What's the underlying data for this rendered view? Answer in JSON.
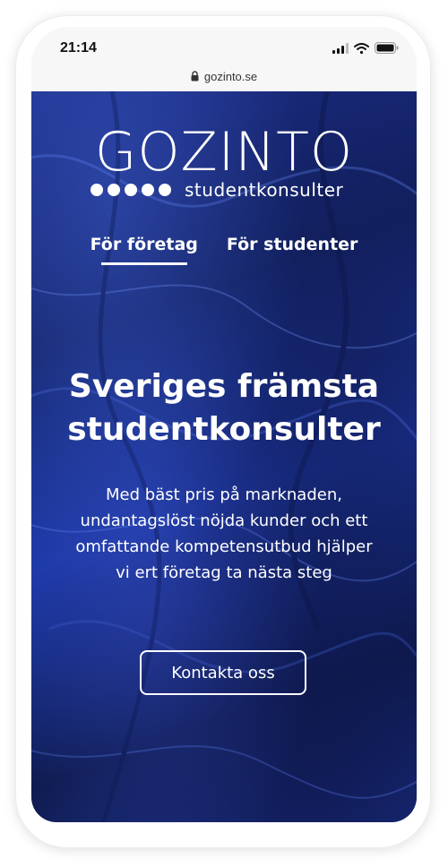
{
  "status_bar": {
    "time": "21:14",
    "icons": [
      "signal-icon",
      "wifi-icon",
      "battery-icon"
    ]
  },
  "browser": {
    "url": "gozinto.se",
    "lock_icon": "lock-icon"
  },
  "logo": {
    "wordmark": "GOZINTO",
    "tagline": "studentkonsulter",
    "dot_count": 5
  },
  "nav": {
    "tabs": [
      {
        "label": "För företag",
        "active": true
      },
      {
        "label": "För studenter",
        "active": false
      }
    ]
  },
  "hero": {
    "headline_line1": "Sveriges främsta",
    "headline_line2": "studentkonsulter",
    "body_line1": "Med bäst pris på marknaden,",
    "body_line2": "undantagslöst nöjda kunder och ett",
    "body_line3": "omfattande kompetensutbud hjälper",
    "body_line4": "vi ert företag ta nästa steg",
    "cta_label": "Kontakta oss"
  },
  "colors": {
    "hero_background": "#1a2f8a",
    "text": "#ffffff",
    "status_bar": "#f7f7f7"
  }
}
